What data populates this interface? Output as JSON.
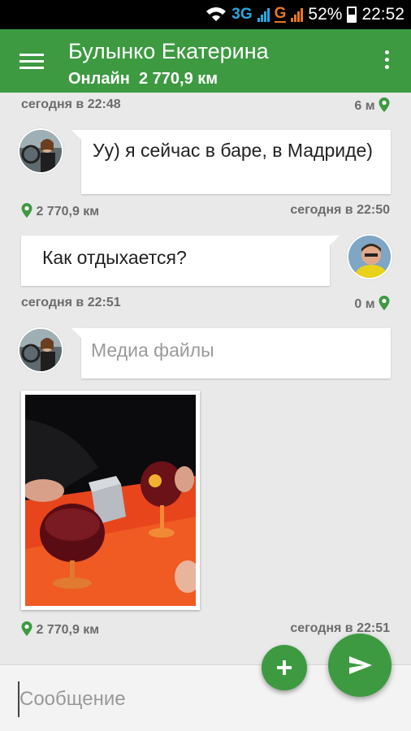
{
  "status_bar": {
    "network_3g": "3G",
    "network_g": "G",
    "battery": "52%",
    "time": "22:52"
  },
  "header": {
    "title": "Булынко Екатерина",
    "status": "Онлайн",
    "distance": "2 770,9 км"
  },
  "messages": [
    {
      "time": "сегодня в 22:48",
      "distance": "6 м"
    },
    {
      "text": "Уу) я сейчас в баре, в Мадриде)",
      "time": "сегодня в 22:50",
      "distance": "2 770,9 км"
    },
    {
      "text": "Как отдыхается?",
      "time": "сегодня в 22:51",
      "distance": "0 м"
    },
    {
      "text": "Медиа файлы",
      "time": "сегодня в 22:51",
      "distance": "2 770,9 км"
    }
  ],
  "composer": {
    "placeholder": "Сообщение"
  },
  "colors": {
    "brand_green": "#3d9a41",
    "background": "#e9e9e9"
  }
}
